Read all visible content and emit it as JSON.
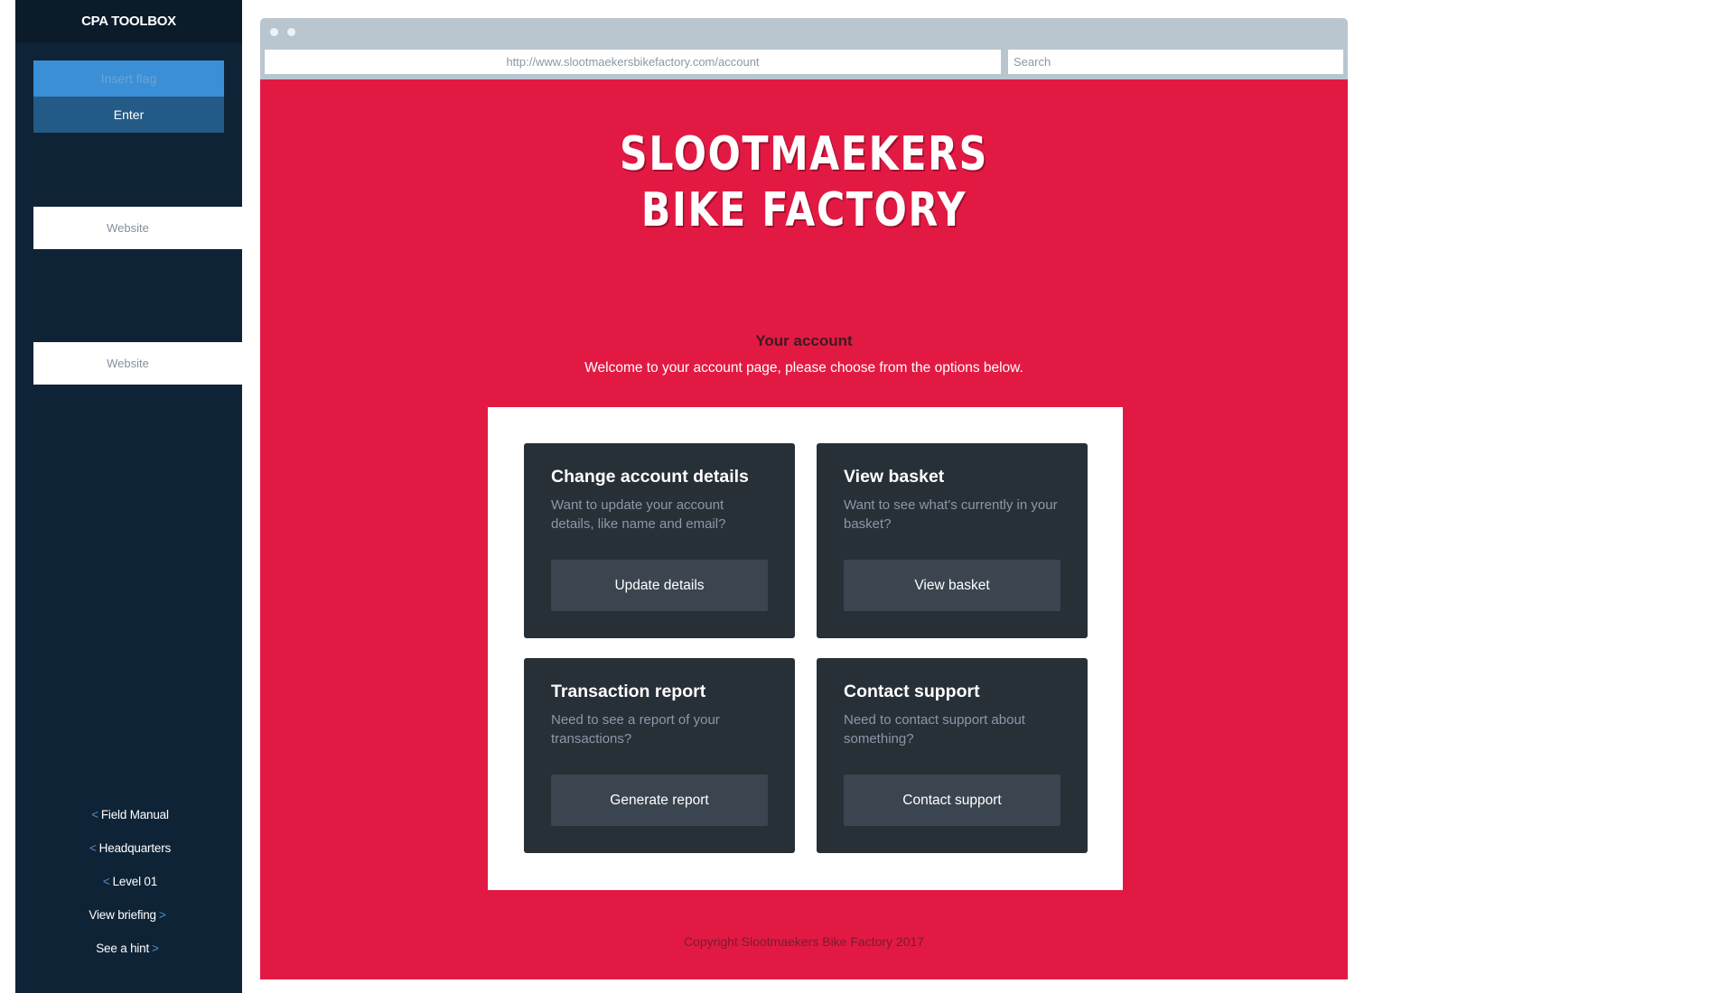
{
  "sidebar": {
    "title": "CPA TOOLBOX",
    "flag_placeholder": "Insert flag",
    "enter_label": "Enter",
    "tabs": [
      {
        "label": "Website"
      },
      {
        "label": "Website"
      }
    ],
    "links": [
      {
        "prefix": "<",
        "label": "Field Manual",
        "suffix": ""
      },
      {
        "prefix": "<",
        "label": "Headquarters",
        "suffix": ""
      },
      {
        "prefix": "<",
        "label": "Level 01",
        "suffix": ""
      },
      {
        "prefix": "",
        "label": "View briefing",
        "suffix": ">"
      },
      {
        "prefix": "",
        "label": "See a hint",
        "suffix": ">"
      }
    ]
  },
  "browser": {
    "url": "http://www.slootmaekersbikefactory.com/account",
    "search_placeholder": "Search"
  },
  "page": {
    "logo_line1": "SLOOTMAEKERS",
    "logo_line2": "BIKE FACTORY",
    "heading": "Your account",
    "subheading": "Welcome to your account page, please choose from the options below.",
    "cards": [
      {
        "title": "Change account details",
        "description": "Want to update your account details, like name and email?",
        "button": "Update details"
      },
      {
        "title": "View basket",
        "description": "Want to see what's currently in your basket?",
        "button": "View basket"
      },
      {
        "title": "Transaction report",
        "description": "Need to see a report of your transactions?",
        "button": "Generate report"
      },
      {
        "title": "Contact support",
        "description": "Need to contact support about something?",
        "button": "Contact support"
      }
    ],
    "copyright": "Copyright Slootmaekers Bike Factory 2017"
  },
  "colors": {
    "sidebar_bg": "#0f2336",
    "page_bg": "#e21a43",
    "card_bg": "#272f37",
    "button_bg": "#3b4550",
    "accent_blue": "#3a8fd6"
  }
}
